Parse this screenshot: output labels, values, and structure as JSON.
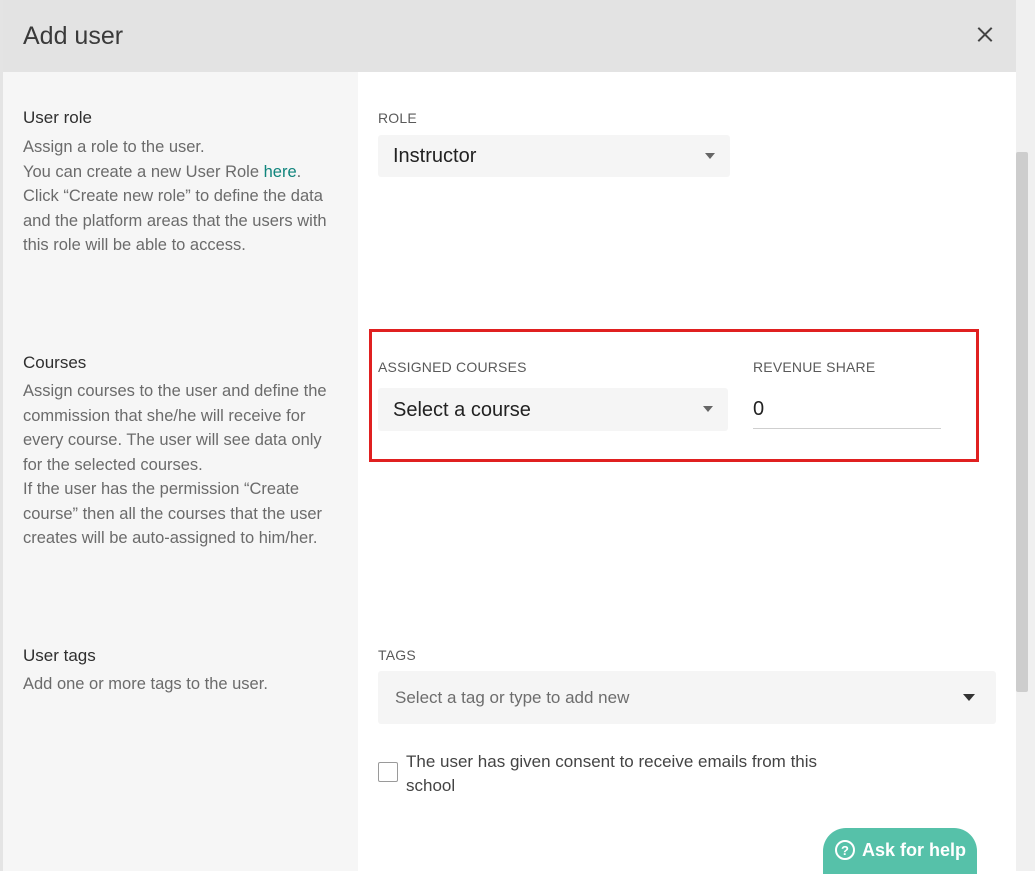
{
  "dialog": {
    "title": "Add user"
  },
  "user_role": {
    "title": "User role",
    "desc_line1": "Assign a role to the user.",
    "desc_line2_prefix": "You can create a new User Role ",
    "desc_link": "here",
    "desc_line2_suffix": ".",
    "desc_line3": "Click “Create new role” to define the data and the platform areas that the users with this role will be able to access.",
    "field_label": "ROLE",
    "field_value": "Instructor"
  },
  "courses": {
    "title": "Courses",
    "desc_line1": "Assign courses to the user and define the commission that she/he will receive for every course. The user will see data only for the selected courses.",
    "desc_line2": "If the user has the permission “Create course” then all the courses that the user creates will be auto-assigned to him/her.",
    "assigned_label": "ASSIGNED COURSES",
    "assigned_value": "Select a course",
    "revenue_label": "REVENUE SHARE",
    "revenue_value": "0"
  },
  "user_tags": {
    "title": "User tags",
    "desc": "Add one or more tags to the user.",
    "field_label": "TAGS",
    "placeholder": "Select a tag or type to add new"
  },
  "consent": {
    "text": "The user has given consent to receive emails from this school",
    "checked": false
  },
  "help": {
    "label": "Ask for help"
  }
}
